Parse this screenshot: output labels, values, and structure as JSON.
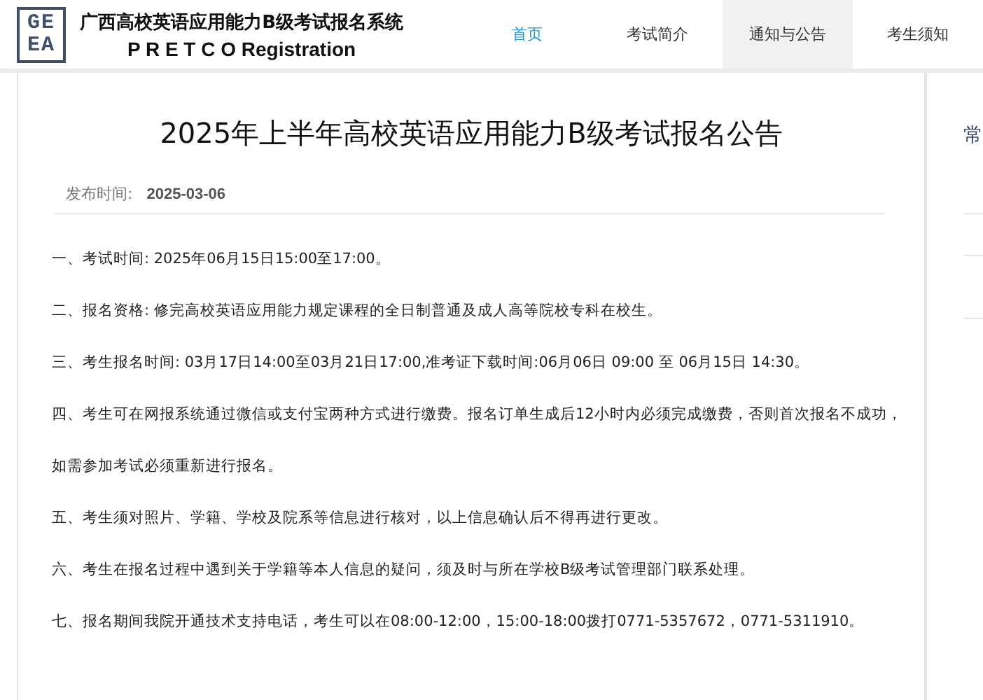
{
  "header": {
    "logo_letters": [
      "GE",
      "EA"
    ],
    "title": "广西高校英语应用能力B级考试报名系统",
    "subtitle": "P R E T C O Registration"
  },
  "nav": [
    {
      "label": "首页",
      "selected": true,
      "current": false
    },
    {
      "label": "考试简介",
      "selected": false,
      "current": false
    },
    {
      "label": "通知与公告",
      "selected": false,
      "current": true
    },
    {
      "label": "考生须知",
      "selected": false,
      "current": false
    }
  ],
  "article": {
    "title": "2025年上半年高校英语应用能力B级考试报名公告",
    "date_label": "发布时间:",
    "date": "2025-03-06",
    "paragraphs": [
      "一、考试时间: 2025年06月15日15:00至17:00。",
      "二、报名资格: 修完高校英语应用能力规定课程的全日制普通及成人高等院校专科在校生。",
      "三、考生报名时间: 03月17日14:00至03月21日17:00,准考证下载时间:06月06日 09:00 至 06月15日 14:30。",
      "四、考生可在网报系统通过微信或支付宝两种方式进行缴费。报名订单生成后12小时内必须完成缴费，否则首次报名不成功，如需参加考试必须重新进行报名。",
      "五、考生须对照片、学籍、学校及院系等信息进行核对，以上信息确认后不得再进行更改。",
      "六、考生在报名过程中遇到关于学籍等本人信息的疑问，须及时与所在学校B级考试管理部门联系处理。",
      "七、报名期间我院开通技术支持电话，考生可以在08:00-12:00，15:00-18:00拨打0771-5357672，0771-5311910。"
    ]
  },
  "sidebar": {
    "title": "常"
  }
}
